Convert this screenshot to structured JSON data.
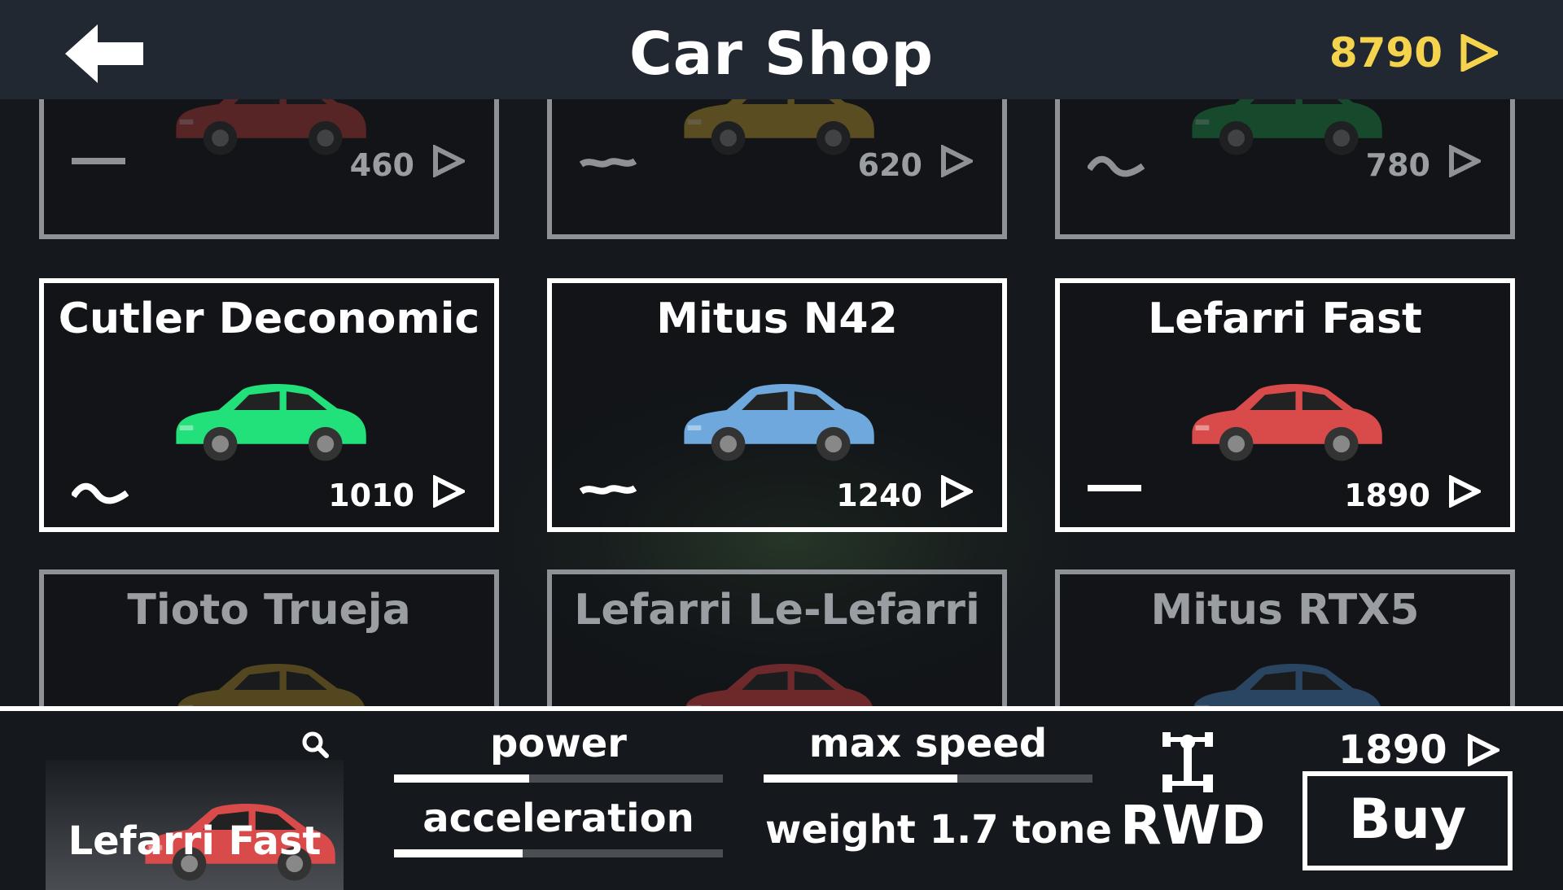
{
  "header": {
    "title": "Car Shop",
    "currency_amount": "8790",
    "currency_icon": "triangle-coin-icon",
    "currency_color": "#f6d34c"
  },
  "grid": {
    "row_top": [
      {
        "name": "",
        "price": "460",
        "car_color": "#c0403f",
        "stat_icon": "flat-line-icon"
      },
      {
        "name": "",
        "price": "620",
        "car_color": "#c9a232",
        "stat_icon": "small-wave-icon"
      },
      {
        "name": "",
        "price": "780",
        "car_color": "#1f9a4a",
        "stat_icon": "wave-icon"
      }
    ],
    "row_middle": [
      {
        "name": "Cutler Deconomic",
        "price": "1010",
        "car_color": "#22e07a",
        "stat_icon": "wave-icon"
      },
      {
        "name": "Mitus N42",
        "price": "1240",
        "car_color": "#6ea8dc",
        "stat_icon": "small-wave-icon"
      },
      {
        "name": "Lefarri Fast",
        "price": "1890",
        "car_color": "#d94b4b",
        "stat_icon": "flat-line-icon",
        "selected": true
      }
    ],
    "row_bottom": [
      {
        "name": "Tioto Trueja",
        "car_color": "#8a7125"
      },
      {
        "name": "Lefarri Le-Lefarri",
        "car_color": "#b83a3a"
      },
      {
        "name": "Mitus RTX5",
        "car_color": "#3f6e9e"
      }
    ]
  },
  "details": {
    "car_name": "Lefarri Fast",
    "car_color": "#d94b4b",
    "power_label": "power",
    "power_level": 0.41,
    "max_speed_label": "max speed",
    "max_speed_level": 0.59,
    "acceleration_label": "acceleration",
    "acceleration_level": 0.39,
    "weight_text": "weight 1.7 tone",
    "drive_icon": "drivetrain-icon",
    "drive_label": "RWD",
    "price": "1890",
    "buy_label": "Buy"
  }
}
